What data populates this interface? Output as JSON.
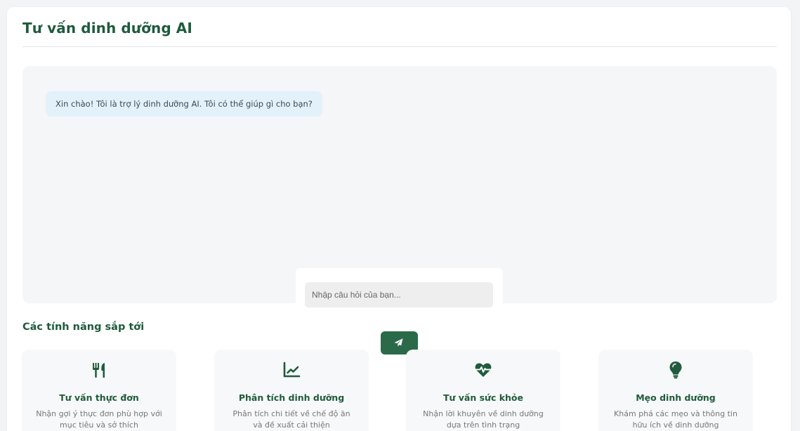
{
  "header": {
    "title": "Tư vấn dinh dưỡng AI"
  },
  "chat": {
    "messages": [
      {
        "role": "assistant",
        "text": "Xin chào! Tôi là trợ lý dinh dưỡng AI. Tôi có thể giúp gì cho bạn?"
      }
    ],
    "input": {
      "placeholder": "Nhập câu hỏi của bạn...",
      "value": ""
    },
    "send_icon": "paper-plane-icon"
  },
  "features": {
    "title": "Các tính năng sắp tới",
    "items": [
      {
        "icon": "utensils-icon",
        "title": "Tư vấn thực đơn",
        "description": "Nhận gợi ý thực đơn phù hợp với mục tiêu và sở thích"
      },
      {
        "icon": "chart-line-icon",
        "title": "Phân tích dinh dưỡng",
        "description": "Phân tích chi tiết về chế độ ăn và đề xuất cải thiện"
      },
      {
        "icon": "heartbeat-icon",
        "title": "Tư vấn sức khỏe",
        "description": "Nhận lời khuyên về dinh dưỡng dựa trên tình trạng"
      },
      {
        "icon": "lightbulb-icon",
        "title": "Mẹo dinh dưỡng",
        "description": "Khám phá các mẹo và thông tin hữu ích về dinh dưỡng"
      }
    ]
  },
  "colors": {
    "brand": "#1f5b3c",
    "button": "#2b6a49",
    "bubble": "#e3f1fb",
    "chat_bg": "#f5f6f8"
  }
}
